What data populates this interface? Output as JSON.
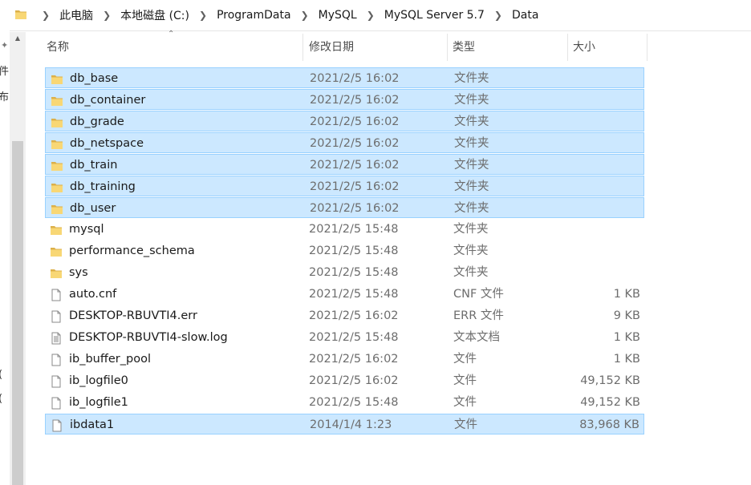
{
  "address_bar": {
    "breadcrumbs": [
      "此电脑",
      "本地磁盘 (C:)",
      "ProgramData",
      "MySQL",
      "MySQL Server 5.7",
      "Data"
    ]
  },
  "nav_fragments": [
    "件+",
    "布",
    "(",
    "("
  ],
  "columns": {
    "name": "名称",
    "date": "修改日期",
    "type": "类型",
    "size": "大小"
  },
  "files": [
    {
      "name": "db_base",
      "date": "2021/2/5 16:02",
      "type": "文件夹",
      "size": "",
      "icon": "folder-icon",
      "selected": true
    },
    {
      "name": "db_container",
      "date": "2021/2/5 16:02",
      "type": "文件夹",
      "size": "",
      "icon": "folder-icon",
      "selected": true
    },
    {
      "name": "db_grade",
      "date": "2021/2/5 16:02",
      "type": "文件夹",
      "size": "",
      "icon": "folder-icon",
      "selected": true
    },
    {
      "name": "db_netspace",
      "date": "2021/2/5 16:02",
      "type": "文件夹",
      "size": "",
      "icon": "folder-icon",
      "selected": true
    },
    {
      "name": "db_train",
      "date": "2021/2/5 16:02",
      "type": "文件夹",
      "size": "",
      "icon": "folder-icon",
      "selected": true
    },
    {
      "name": "db_training",
      "date": "2021/2/5 16:02",
      "type": "文件夹",
      "size": "",
      "icon": "folder-icon",
      "selected": true
    },
    {
      "name": "db_user",
      "date": "2021/2/5 16:02",
      "type": "文件夹",
      "size": "",
      "icon": "folder-icon",
      "selected": true
    },
    {
      "name": "mysql",
      "date": "2021/2/5 15:48",
      "type": "文件夹",
      "size": "",
      "icon": "folder-icon",
      "selected": false
    },
    {
      "name": "performance_schema",
      "date": "2021/2/5 15:48",
      "type": "文件夹",
      "size": "",
      "icon": "folder-icon",
      "selected": false
    },
    {
      "name": "sys",
      "date": "2021/2/5 15:48",
      "type": "文件夹",
      "size": "",
      "icon": "folder-icon",
      "selected": false
    },
    {
      "name": "auto.cnf",
      "date": "2021/2/5 15:48",
      "type": "CNF 文件",
      "size": "1 KB",
      "icon": "file-icon",
      "selected": false
    },
    {
      "name": "DESKTOP-RBUVTI4.err",
      "date": "2021/2/5 16:02",
      "type": "ERR 文件",
      "size": "9 KB",
      "icon": "file-icon",
      "selected": false
    },
    {
      "name": "DESKTOP-RBUVTI4-slow.log",
      "date": "2021/2/5 15:48",
      "type": "文本文档",
      "size": "1 KB",
      "icon": "text-file-icon",
      "selected": false
    },
    {
      "name": "ib_buffer_pool",
      "date": "2021/2/5 16:02",
      "type": "文件",
      "size": "1 KB",
      "icon": "file-icon",
      "selected": false
    },
    {
      "name": "ib_logfile0",
      "date": "2021/2/5 16:02",
      "type": "文件",
      "size": "49,152 KB",
      "icon": "file-icon",
      "selected": false
    },
    {
      "name": "ib_logfile1",
      "date": "2021/2/5 15:48",
      "type": "文件",
      "size": "49,152 KB",
      "icon": "file-icon",
      "selected": false
    },
    {
      "name": "ibdata1",
      "date": "2014/1/4 1:23",
      "type": "文件",
      "size": "83,968 KB",
      "icon": "file-icon",
      "selected": true
    }
  ],
  "colors": {
    "selection_bg": "#cce8ff",
    "selection_border": "#99d1ff",
    "folder": "#f8d775"
  }
}
